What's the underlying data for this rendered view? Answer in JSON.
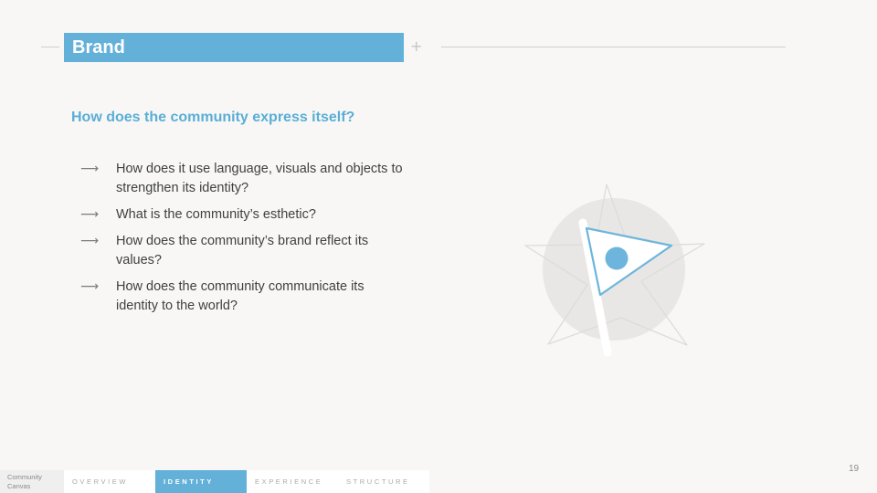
{
  "header": {
    "title": "Brand",
    "plus_icon": "plus-icon"
  },
  "content": {
    "subtitle": "How does the community express itself?",
    "arrow_glyph": "⟶",
    "questions": [
      "How does it use language, visuals and objects to strengthen its identity?",
      "What is the community’s esthetic?",
      "How does the community’s brand reflect its values?",
      "How does the community communicate its identity to the world?"
    ]
  },
  "illustration": {
    "icon": "flag-with-star-icon",
    "colors": {
      "circle": "#e8e7e6",
      "flag_stroke": "#6db5dc",
      "dot": "#6db5dc",
      "star": "#dcdcdc"
    }
  },
  "footer": {
    "brand": [
      "Community",
      "Canvas"
    ],
    "tabs": [
      "OVERVIEW",
      "IDENTITY",
      "EXPERIENCE",
      "STRUCTURE"
    ],
    "active_tab": "IDENTITY"
  },
  "page_number": "19",
  "colors": {
    "accent": "#63b0d9",
    "background": "#f8f7f6"
  }
}
